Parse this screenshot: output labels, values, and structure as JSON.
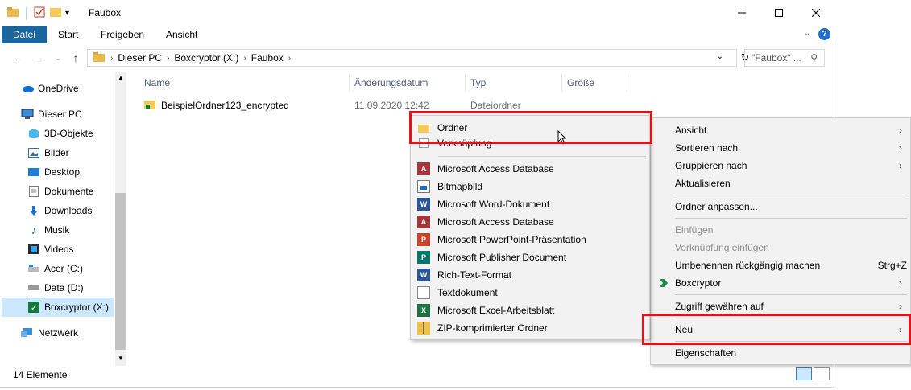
{
  "window": {
    "title": "Faubox"
  },
  "ribbon": {
    "tabs": [
      "Datei",
      "Start",
      "Freigeben",
      "Ansicht"
    ]
  },
  "address": {
    "crumbs": [
      "Dieser PC",
      "Boxcryptor (X:)",
      "Faubox"
    ],
    "search_placeholder": "\"Faubox\" ..."
  },
  "nav": {
    "items": [
      "OneDrive",
      "Dieser PC",
      "3D-Objekte",
      "Bilder",
      "Desktop",
      "Dokumente",
      "Downloads",
      "Musik",
      "Videos",
      "Acer (C:)",
      "Data (D:)",
      "Boxcryptor (X:)",
      "Netzwerk"
    ]
  },
  "columns": {
    "name": "Name",
    "date": "Änderungsdatum",
    "type": "Typ",
    "size": "Größe"
  },
  "files": [
    {
      "name": "BeispielOrdner123_encrypted",
      "date": "11.09.2020 12:42",
      "type": "Dateiordner"
    }
  ],
  "status": {
    "count": "14 Elemente"
  },
  "context_menu": {
    "items": [
      "Ansicht",
      "Sortieren nach",
      "Gruppieren nach",
      "Aktualisieren",
      "Ordner anpassen...",
      "Einfügen",
      "Verknüpfung einfügen",
      "Umbenennen rückgängig machen",
      "Boxcryptor",
      "Zugriff gewähren auf",
      "Neu",
      "Eigenschaften"
    ],
    "undo_shortcut": "Strg+Z"
  },
  "new_submenu": {
    "items": [
      "Ordner",
      "Verknüpfung",
      "Microsoft Access Database",
      "Bitmapbild",
      "Microsoft Word-Dokument",
      "Microsoft Access Database",
      "Microsoft PowerPoint-Präsentation",
      "Microsoft Publisher Document",
      "Rich-Text-Format",
      "Textdokument",
      "Microsoft Excel-Arbeitsblatt",
      "ZIP-komprimierter Ordner"
    ]
  },
  "colors": {
    "file_tab": "#19659e",
    "selection": "#cce8ff",
    "highlight_box": "#e0121a",
    "menu_bg": "#f2f2f2"
  }
}
